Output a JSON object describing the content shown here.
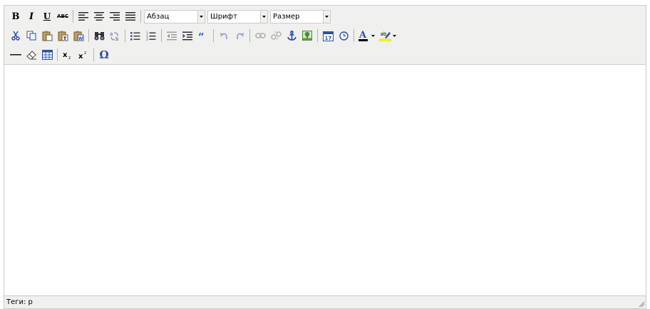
{
  "toolbar": {
    "row1": {
      "bold_glyph": "B",
      "italic_glyph": "I",
      "underline_glyph": "U",
      "strike_glyph": "ABC",
      "format_select": "Абзац",
      "font_select": "Шрифт",
      "size_select": "Размер"
    },
    "row2": {
      "forecolor_glyph": "A",
      "highlight_glyph": "ab"
    },
    "row3": {
      "omega_glyph": "Ω"
    }
  },
  "statusbar": {
    "path_text": "Теги: p"
  },
  "colors": {
    "toolbar_bg": "#f0f0ee",
    "border": "#cccccc",
    "forecolor_bar": "#000000",
    "highlight_bar": "#ffff00",
    "icon_blue": "#2d4fa6"
  }
}
